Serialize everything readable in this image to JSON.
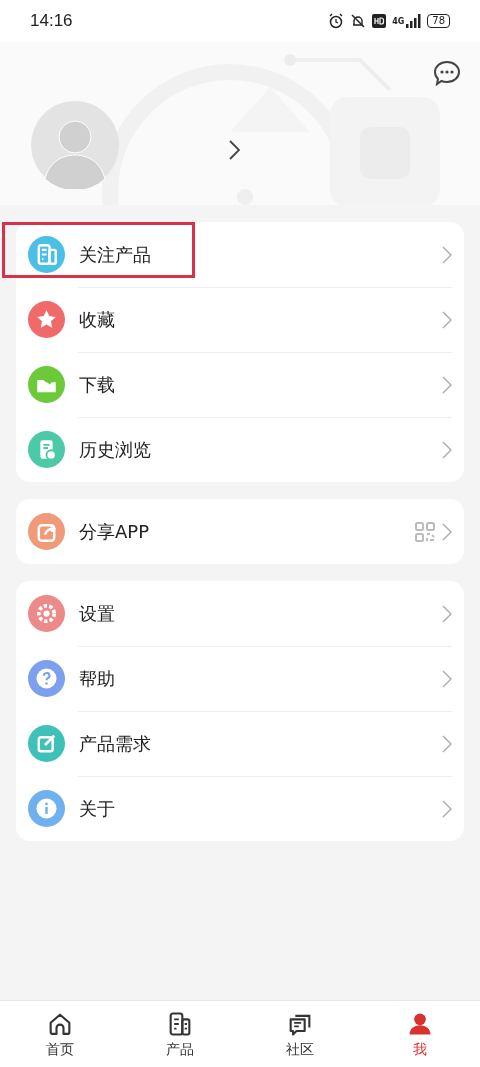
{
  "status_bar": {
    "time": "14:16",
    "battery": "78",
    "network": "4G"
  },
  "groups": [
    {
      "items": [
        {
          "label": "关注产品",
          "kind": "product",
          "color": "#4bbfe6",
          "highlighted": true
        },
        {
          "label": "收藏",
          "kind": "star",
          "color": "#f06a6a",
          "highlighted": false
        },
        {
          "label": "下载",
          "kind": "download",
          "color": "#6cc93a",
          "highlighted": false
        },
        {
          "label": "历史浏览",
          "kind": "history",
          "color": "#4ccaa8",
          "highlighted": false
        }
      ]
    },
    {
      "items": [
        {
          "label": "分享APP",
          "kind": "share",
          "color": "#f09a7a",
          "highlighted": false,
          "qr": true
        }
      ]
    },
    {
      "items": [
        {
          "label": "设置",
          "kind": "gear",
          "color": "#ec8a8a",
          "highlighted": false
        },
        {
          "label": "帮助",
          "kind": "help",
          "color": "#7d9ff0",
          "highlighted": false
        },
        {
          "label": "产品需求",
          "kind": "edit",
          "color": "#3fc0b8",
          "highlighted": false
        },
        {
          "label": "关于",
          "kind": "info",
          "color": "#6fb0ee",
          "highlighted": false
        }
      ]
    }
  ],
  "nav": [
    {
      "label": "首页",
      "kind": "home",
      "selected": false
    },
    {
      "label": "产品",
      "kind": "product",
      "selected": false
    },
    {
      "label": "社区",
      "kind": "chat",
      "selected": false
    },
    {
      "label": "我",
      "kind": "person",
      "selected": true
    }
  ]
}
